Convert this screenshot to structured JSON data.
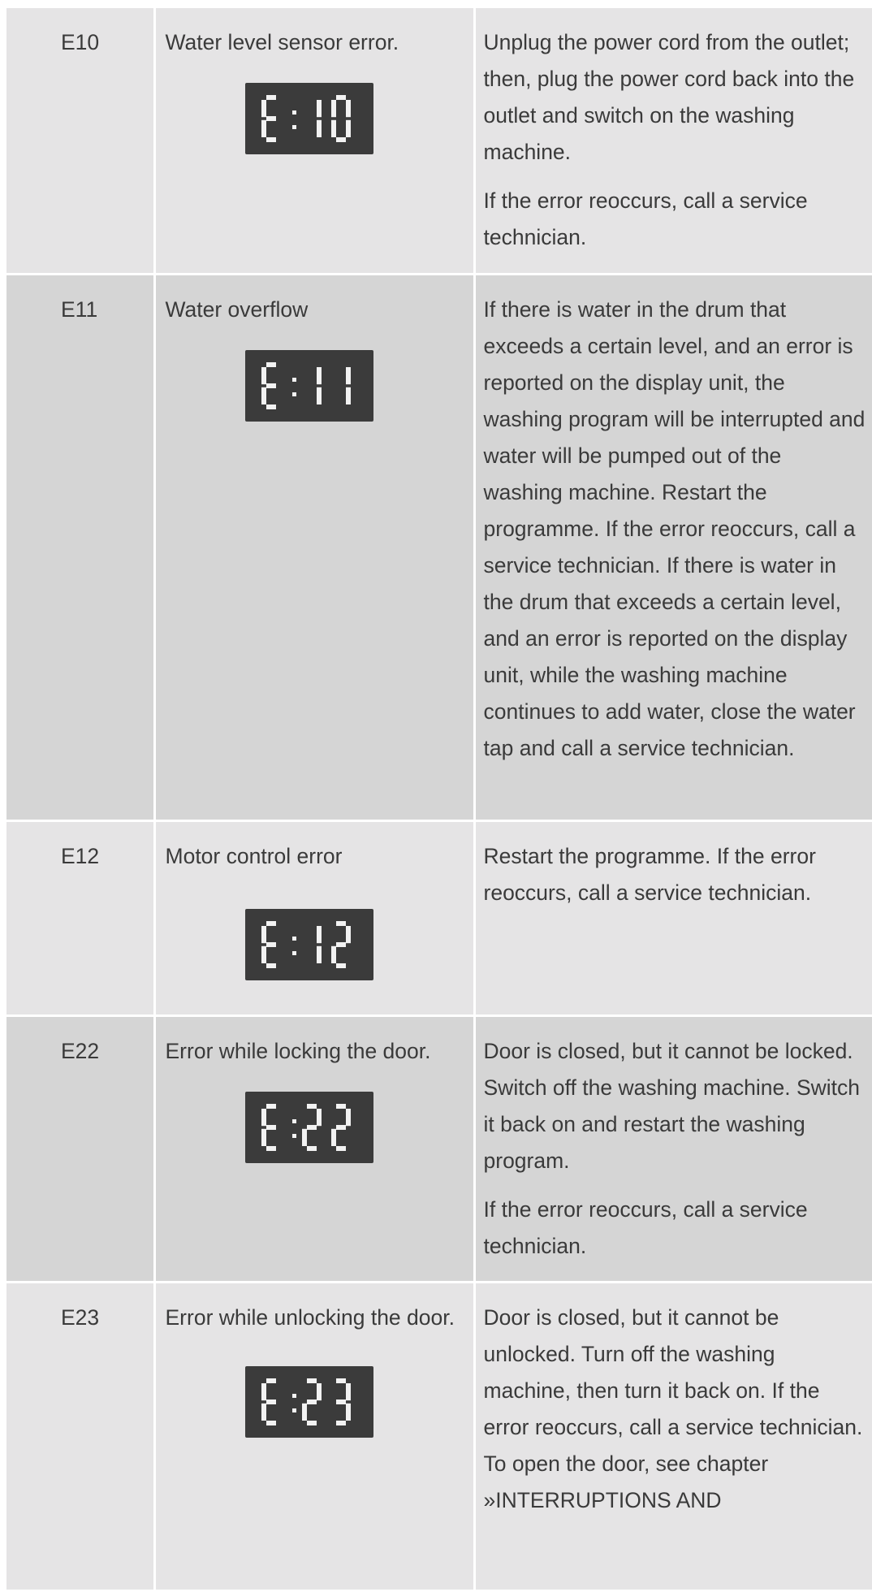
{
  "rows": [
    {
      "code": "E10",
      "description": "Water level sensor error.",
      "display": "E:10",
      "solution": [
        "Unplug the power cord from the outlet; then, plug the power cord back into the outlet and switch on the washing machine.",
        "If the error reoccurs, call a service technician."
      ]
    },
    {
      "code": "E11",
      "description": "Water overflow",
      "display": "E:11",
      "solution": [
        "If there is water in the drum that exceeds a certain level, and an error is reported on the display unit, the washing program will be interrupted and water will be pumped out of the washing machine. Restart the programme. If the error reoccurs, call a service technician. If there is water in the drum that exceeds a certain level, and an error is reported on the display unit, while the washing machine continues to add water, close the water tap and call a service technician."
      ]
    },
    {
      "code": "E12",
      "description": "Motor control error",
      "display": "E:12",
      "solution": [
        "Restart the programme. If the error reoccurs, call a service technician."
      ]
    },
    {
      "code": "E22",
      "description": "Error while locking the door.",
      "display": "E:22",
      "solution": [
        "Door is closed, but it cannot be locked. Switch off the washing machine. Switch it back on and restart the washing program.",
        "If the error reoccurs, call a service technician."
      ]
    },
    {
      "code": "E23",
      "description": "Error while unlocking the door.",
      "display": "E:23",
      "solution": [
        "Door is closed, but it cannot be unlocked. Turn off the washing machine, then turn it back on. If the error reoccurs, call a service technician. To open the door, see chapter »INTERRUPTIONS AND"
      ]
    }
  ]
}
